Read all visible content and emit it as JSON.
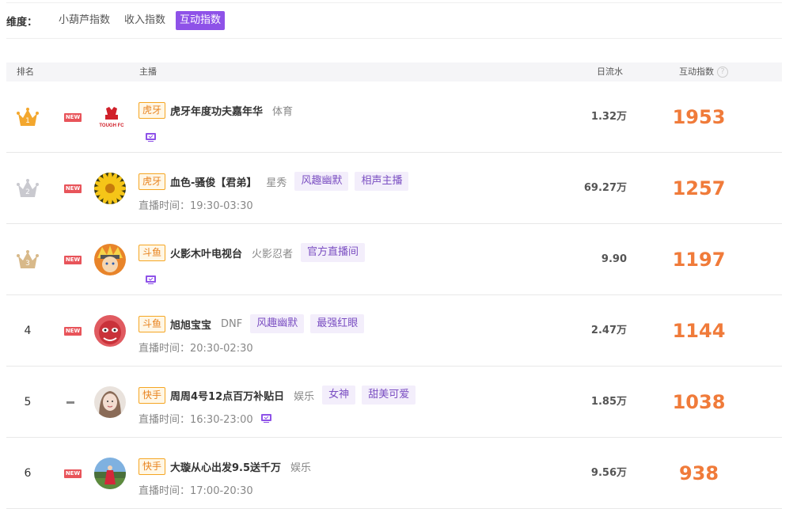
{
  "filter": {
    "label": "维度：",
    "options": [
      "小葫芦指数",
      "收入指数",
      "互动指数"
    ],
    "active_index": 2
  },
  "table": {
    "headers": {
      "rank": "排名",
      "anchor": "主播",
      "flow": "日流水",
      "score": "互动指数",
      "help": "?"
    },
    "rows": [
      {
        "rank": "1",
        "rank_style": "gold-crown",
        "trend": "NEW",
        "platform": "虎牙",
        "name": "虎牙年度功夫嘉年华",
        "category": "体育",
        "tags": [],
        "live_time": "",
        "tv_icon": true,
        "flow": "1.32万",
        "score": "1953",
        "avatar": "tough-fc-logo",
        "logo_text": "TOUGH FC"
      },
      {
        "rank": "2",
        "rank_style": "silver-crown",
        "trend": "NEW",
        "platform": "虎牙",
        "name": "血色-骚俊【君弟】",
        "category": "星秀",
        "tags": [
          "风趣幽默",
          "相声主播"
        ],
        "live_time": "直播时间：19:30-03:30",
        "tv_icon": false,
        "flow": "69.27万",
        "score": "1257",
        "avatar": "sunflower"
      },
      {
        "rank": "3",
        "rank_style": "bronze-crown",
        "trend": "NEW",
        "platform": "斗鱼",
        "name": "火影木叶电视台",
        "category": "火影忍者",
        "tags": [
          "官方直播间"
        ],
        "live_time": "",
        "tv_icon": true,
        "flow": "9.90",
        "score": "1197",
        "avatar": "naruto"
      },
      {
        "rank": "4",
        "rank_style": "number",
        "trend": "NEW",
        "platform": "斗鱼",
        "name": "旭旭宝宝",
        "category": "DNF",
        "tags": [
          "风趣幽默",
          "最强红眼"
        ],
        "live_time": "直播时间：20:30-02:30",
        "tv_icon": false,
        "flow": "2.47万",
        "score": "1144",
        "avatar": "red-face"
      },
      {
        "rank": "5",
        "rank_style": "number",
        "trend": "-",
        "platform": "快手",
        "name": "周周4号12点百万补贴日",
        "category": "娱乐",
        "tags": [
          "女神",
          "甜美可爱"
        ],
        "live_time": "直播时间：16:30-23:00",
        "tv_icon": true,
        "flow": "1.85万",
        "score": "1038",
        "avatar": "girl"
      },
      {
        "rank": "6",
        "rank_style": "number",
        "trend": "NEW",
        "platform": "快手",
        "name": "大璇从心出发9.5送千万",
        "category": "娱乐",
        "tags": [],
        "live_time": "直播时间：17:00-20:30",
        "tv_icon": false,
        "flow": "9.56万",
        "score": "938",
        "avatar": "outdoor-girl"
      }
    ]
  },
  "colors": {
    "accent": "#8e52e8",
    "score": "#f07b3a",
    "new": "#e8545a",
    "platform_border": "#f5a623",
    "tag_bg": "#f3eefb",
    "tag_text": "#7b4fc2"
  }
}
